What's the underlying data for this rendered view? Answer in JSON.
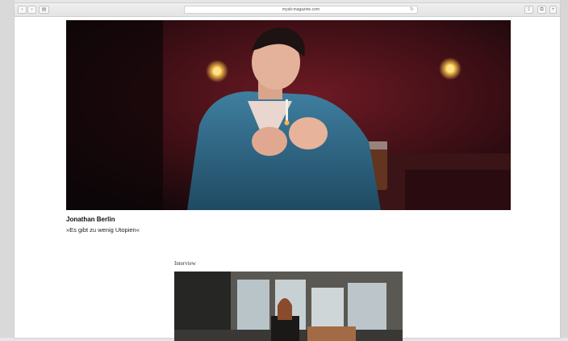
{
  "browser": {
    "url": "mysb-magazine.com",
    "back_glyph": "‹",
    "forward_glyph": "›",
    "sidebar_glyph": "▤",
    "share_glyph": "⇪",
    "tabs_glyph": "⧉",
    "reload_glyph": "↻",
    "add_glyph": "+"
  },
  "article": {
    "name": "Jonathan Berlin",
    "quote": "»Es gibt zu wenig Utopien«"
  },
  "section": {
    "label": "Interview"
  },
  "colors": {
    "hero_bg": "#2a0f12",
    "accent_red": "#8b1e2a"
  }
}
